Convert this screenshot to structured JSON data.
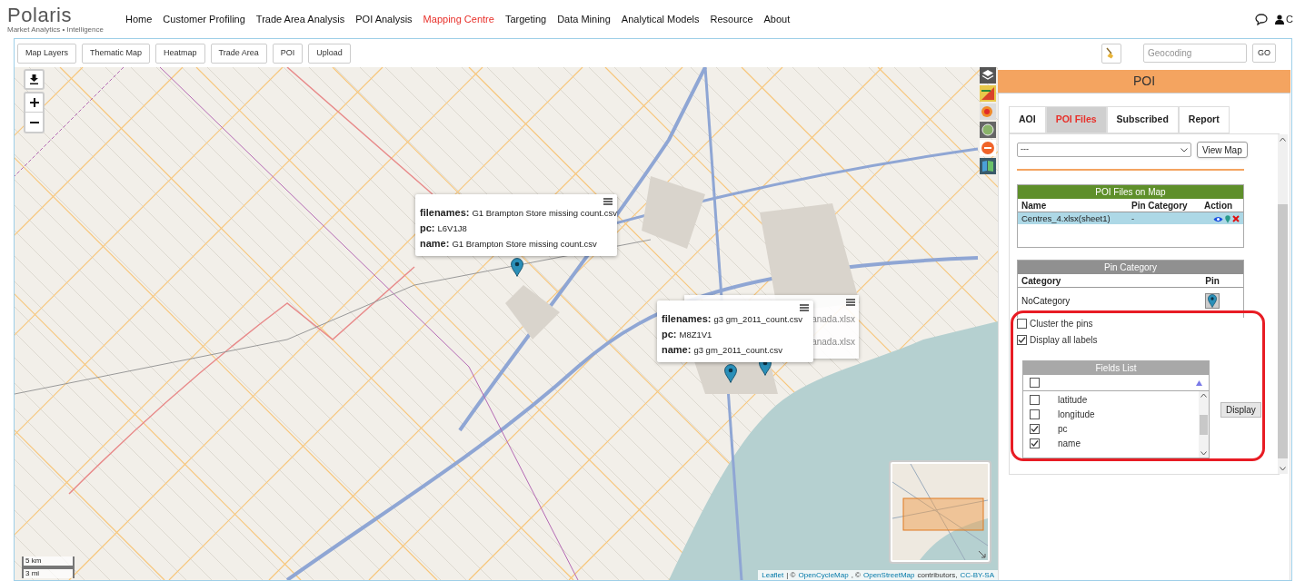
{
  "logo": {
    "name": "Polaris",
    "tagline": "Market Analytics • Intelligence"
  },
  "nav": [
    {
      "label": "Home",
      "selected": false
    },
    {
      "label": "Customer Profiling",
      "selected": false
    },
    {
      "label": "Trade Area Analysis",
      "selected": false
    },
    {
      "label": "POI Analysis",
      "selected": false
    },
    {
      "label": "Mapping Centre",
      "selected": true
    },
    {
      "label": "Targeting",
      "selected": false
    },
    {
      "label": "Data Mining",
      "selected": false
    },
    {
      "label": "Analytical Models",
      "selected": false
    },
    {
      "label": "Resource",
      "selected": false
    },
    {
      "label": "About",
      "selected": false
    }
  ],
  "user": {
    "initial": "C"
  },
  "toolbar": {
    "buttons": [
      "Map Layers",
      "Thematic Map",
      "Heatmap",
      "Trade Area",
      "POI",
      "Upload"
    ],
    "geocoding": {
      "placeholder": "Geocoding"
    },
    "go": "GO"
  },
  "map": {
    "popups": [
      {
        "fields": [
          {
            "key": "filenames:",
            "value": "G1 Brampton Store missing count.csv"
          },
          {
            "key": "pc:",
            "value": "L6V1J8"
          },
          {
            "key": "name:",
            "value": "G1 Brampton Store missing count.csv"
          }
        ]
      },
      {
        "fields": [
          {
            "key": "filenames:",
            "value": "g3 gm_2011_count.csv"
          },
          {
            "key": "pc:",
            "value": "M8Z1V1"
          },
          {
            "key": "name:",
            "value": "g3 gm_2011_count.csv"
          }
        ]
      }
    ],
    "hidden_popup_fragments": [
      "anada.xlsx",
      "anada.xlsx"
    ],
    "scale": [
      "5 km",
      "3 mi"
    ],
    "attribution": [
      {
        "text": "Leaflet",
        "link": true
      },
      {
        "text": "| ©",
        "link": false
      },
      {
        "text": "OpenCycleMap",
        "link": true
      },
      {
        "text": ", ©",
        "link": false
      },
      {
        "text": "OpenStreetMap",
        "link": true
      },
      {
        "text": "contributors,",
        "link": false
      },
      {
        "text": "CC-BY-SA",
        "link": true
      }
    ]
  },
  "panel": {
    "title": "POI",
    "tabs": [
      {
        "label": "AOI",
        "selected": false
      },
      {
        "label": "POI Files",
        "selected": true
      },
      {
        "label": "Subscribed",
        "selected": false
      },
      {
        "label": "Report",
        "selected": false
      }
    ],
    "pin_select": {
      "value": "---"
    },
    "view_map": "View Map",
    "files_table": {
      "title": "POI Files on Map",
      "columns": [
        "Name",
        "Pin Category",
        "Action"
      ],
      "rows": [
        {
          "name": "Centres_4.xlsx(sheet1)",
          "pin_category": "-",
          "selected": true
        }
      ]
    },
    "category_table": {
      "title": "Pin Category",
      "columns": [
        "Category",
        "Pin"
      ],
      "rows": [
        {
          "category": "NoCategory"
        }
      ]
    },
    "options": [
      {
        "label": "Cluster the pins",
        "checked": false
      },
      {
        "label": "Display all labels",
        "checked": true
      }
    ],
    "fields_list": {
      "title": "Fields List",
      "all_checked": false,
      "fields": [
        {
          "label": "latitude",
          "checked": false
        },
        {
          "label": "longitude",
          "checked": false
        },
        {
          "label": "pc",
          "checked": true
        },
        {
          "label": "name",
          "checked": true
        }
      ]
    },
    "display": "Display"
  }
}
